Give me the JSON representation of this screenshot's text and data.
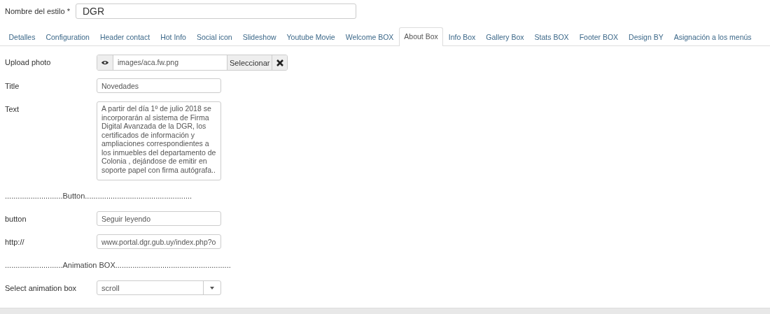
{
  "style_name": {
    "label": "Nombre del estilo *",
    "value": "DGR"
  },
  "tabs": [
    {
      "label": "Detalles",
      "selected": false
    },
    {
      "label": "Configuration",
      "selected": false
    },
    {
      "label": "Header contact",
      "selected": false
    },
    {
      "label": "Hot Info",
      "selected": false
    },
    {
      "label": "Social icon",
      "selected": false
    },
    {
      "label": "Slideshow",
      "selected": false
    },
    {
      "label": "Youtube Movie",
      "selected": false
    },
    {
      "label": "Welcome BOX",
      "selected": false
    },
    {
      "label": "About Box",
      "selected": true
    },
    {
      "label": "Info Box",
      "selected": false
    },
    {
      "label": "Gallery Box",
      "selected": false
    },
    {
      "label": "Stats BOX",
      "selected": false
    },
    {
      "label": "Footer BOX",
      "selected": false
    },
    {
      "label": "Design BY",
      "selected": false
    },
    {
      "label": "Asignación a los menús",
      "selected": false
    }
  ],
  "fields": [
    {
      "kind": "media",
      "label": "Upload photo",
      "value": "images/aca.fw.png",
      "button": "Seleccionar"
    },
    {
      "kind": "text",
      "label": "Title",
      "value": "Novedades"
    },
    {
      "kind": "textarea",
      "label": "Text",
      "value": "A partir del día 1º de julio 2018 se incorporarán al sistema de Firma Digital Avanzada de la DGR, los certificados de información y ampliaciones correspondientes a los inmuebles del departamento de Colonia , dejándose de emitir en soporte papel con firma autógrafa.."
    },
    {
      "kind": "separator",
      "label": "...........................Button.................................................."
    },
    {
      "kind": "text",
      "label": "button",
      "value": "Seguir leyendo"
    },
    {
      "kind": "text",
      "label": "http://",
      "value": "www.portal.dgr.gub.uy/index.php?o"
    },
    {
      "kind": "separator",
      "label": "...........................Animation BOX......................................................"
    },
    {
      "kind": "select",
      "label": "Select animation box",
      "value": "scroll"
    }
  ]
}
